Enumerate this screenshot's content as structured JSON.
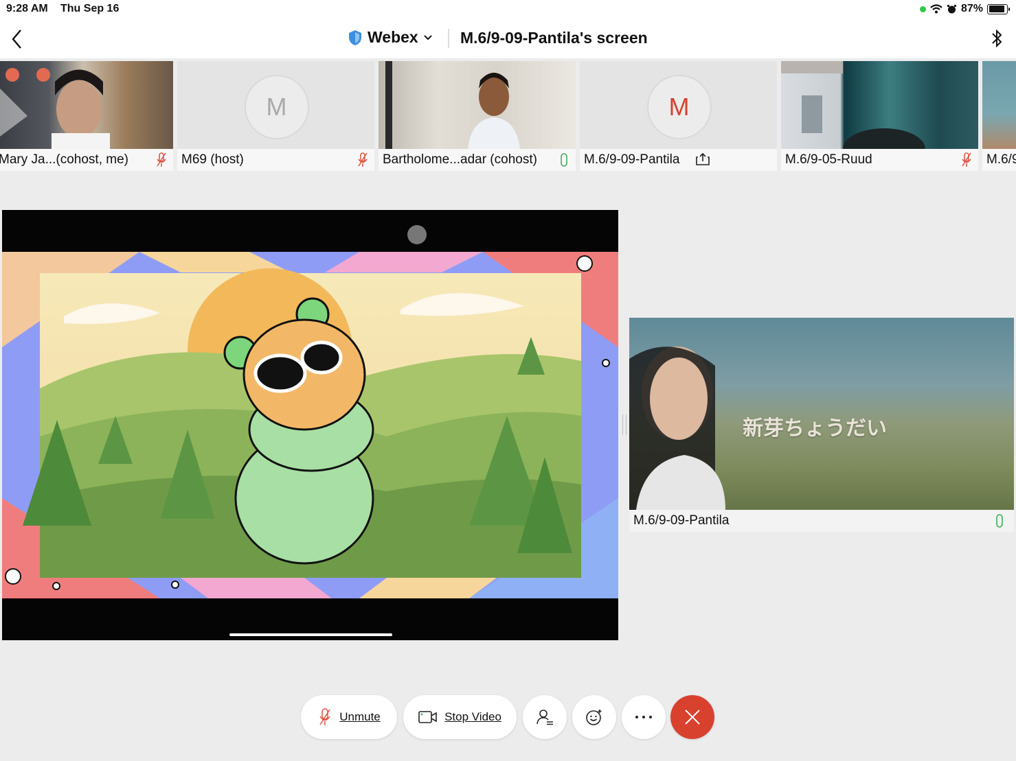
{
  "status_bar": {
    "time": "9:28 AM",
    "date": "Thu Sep 16",
    "battery": "87%"
  },
  "header": {
    "app_name": "Webex",
    "screen_title": "M.6/9-09-Pantila's screen"
  },
  "participants": [
    {
      "name": "Mary Ja...(cohost, me)",
      "mic": "muted"
    },
    {
      "name": "M69 (host)",
      "mic": "muted",
      "avatar": "M"
    },
    {
      "name": "Bartholome...adar (cohost)",
      "mic": "active"
    },
    {
      "name": "M.6/9-09-Pantila",
      "status": "sharing",
      "avatar": "M"
    },
    {
      "name": "M.6/9-05-Ruud",
      "mic": "muted"
    },
    {
      "name": "M.6/9"
    }
  ],
  "side_video": {
    "name": "M.6/9-09-Pantila",
    "overlay_text": "新芽ちょうだい",
    "mic": "active"
  },
  "controls": {
    "unmute": "Unmute",
    "stop_video": "Stop Video"
  },
  "colors": {
    "accent_red": "#d9412f",
    "muted_red": "#e05a47",
    "active_green": "#3fae58"
  }
}
